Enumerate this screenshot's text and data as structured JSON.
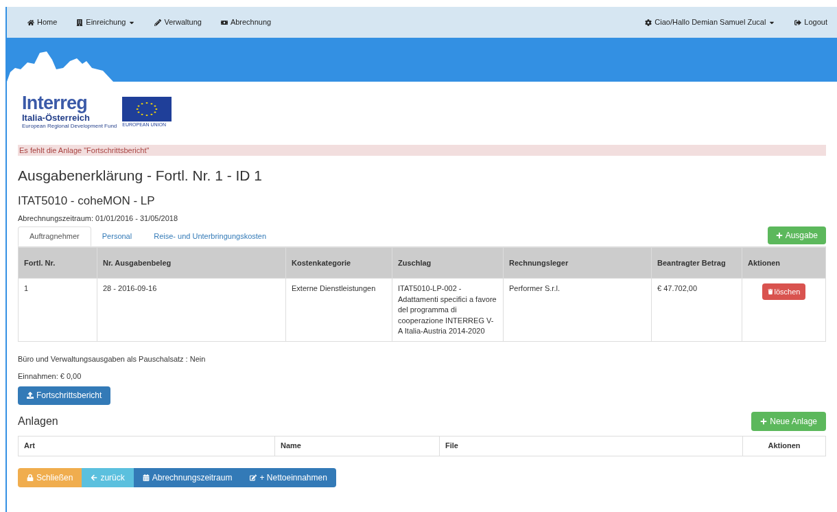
{
  "navbar": {
    "left": [
      {
        "label": "Home",
        "dropdown": false
      },
      {
        "label": "Einreichung",
        "dropdown": true
      },
      {
        "label": "Verwaltung",
        "dropdown": false
      },
      {
        "label": "Abrechnung",
        "dropdown": false
      }
    ],
    "right": [
      {
        "label": "Ciao/Hallo Demian Samuel Zucal",
        "dropdown": true
      },
      {
        "label": "Logout",
        "dropdown": false
      }
    ]
  },
  "logo": {
    "name": "Interreg",
    "region": "Italia-Österreich",
    "fund": "European Regional Development Fund",
    "eu": "EUROPEAN UNION"
  },
  "alert": "Es fehlt die Anlage \"Fortschrittsbericht\"",
  "title": "Ausgabenerklärung - Fortl. Nr. 1 - ID 1",
  "subtitle": "ITAT5010 - coheMON - LP",
  "period": "Abrechnungszeitraum: 01/01/2016 - 31/05/2018",
  "tabs": [
    {
      "label": "Auftragnehmer",
      "selected": true
    },
    {
      "label": "Personal",
      "selected": false
    },
    {
      "label": "Reise- und Unterbringungskosten",
      "selected": false
    }
  ],
  "add_button": "Ausgabe",
  "table": {
    "columns": [
      "Fortl. Nr.",
      "Nr. Ausgabenbeleg",
      "Kostenkategorie",
      "Zuschlag",
      "Rechnungsleger",
      "Beantragter Betrag",
      "Aktionen"
    ],
    "rows": [
      {
        "cells": [
          "1",
          "28 - 2016-09-16",
          "Externe Dienstleistungen",
          "ITAT5010-LP-002 - Adattamenti specifici a favore del programma di cooperazione INTERREG V-A Italia-Austria 2014-2020",
          "Performer S.r.l.",
          "€ 47.702,00"
        ],
        "action": "löschen"
      }
    ]
  },
  "flat_rate": "Büro und Verwaltungsausgaben als Pauschalsatz : Nein",
  "income": "Einnahmen: € 0,00",
  "upload_button": "Fortschrittsbericht",
  "attachments": {
    "title": "Anlagen",
    "add_button": "Neue Anlage",
    "columns": [
      "Art",
      "Name",
      "File",
      "Aktionen"
    ]
  },
  "footer_buttons": [
    {
      "kind": "warning",
      "label": "Schließen"
    },
    {
      "kind": "info",
      "label": "zurück"
    },
    {
      "kind": "primary",
      "label": "Abrechnungszeitraum"
    },
    {
      "kind": "primary",
      "label": "+ Nettoeinnahmen"
    }
  ]
}
